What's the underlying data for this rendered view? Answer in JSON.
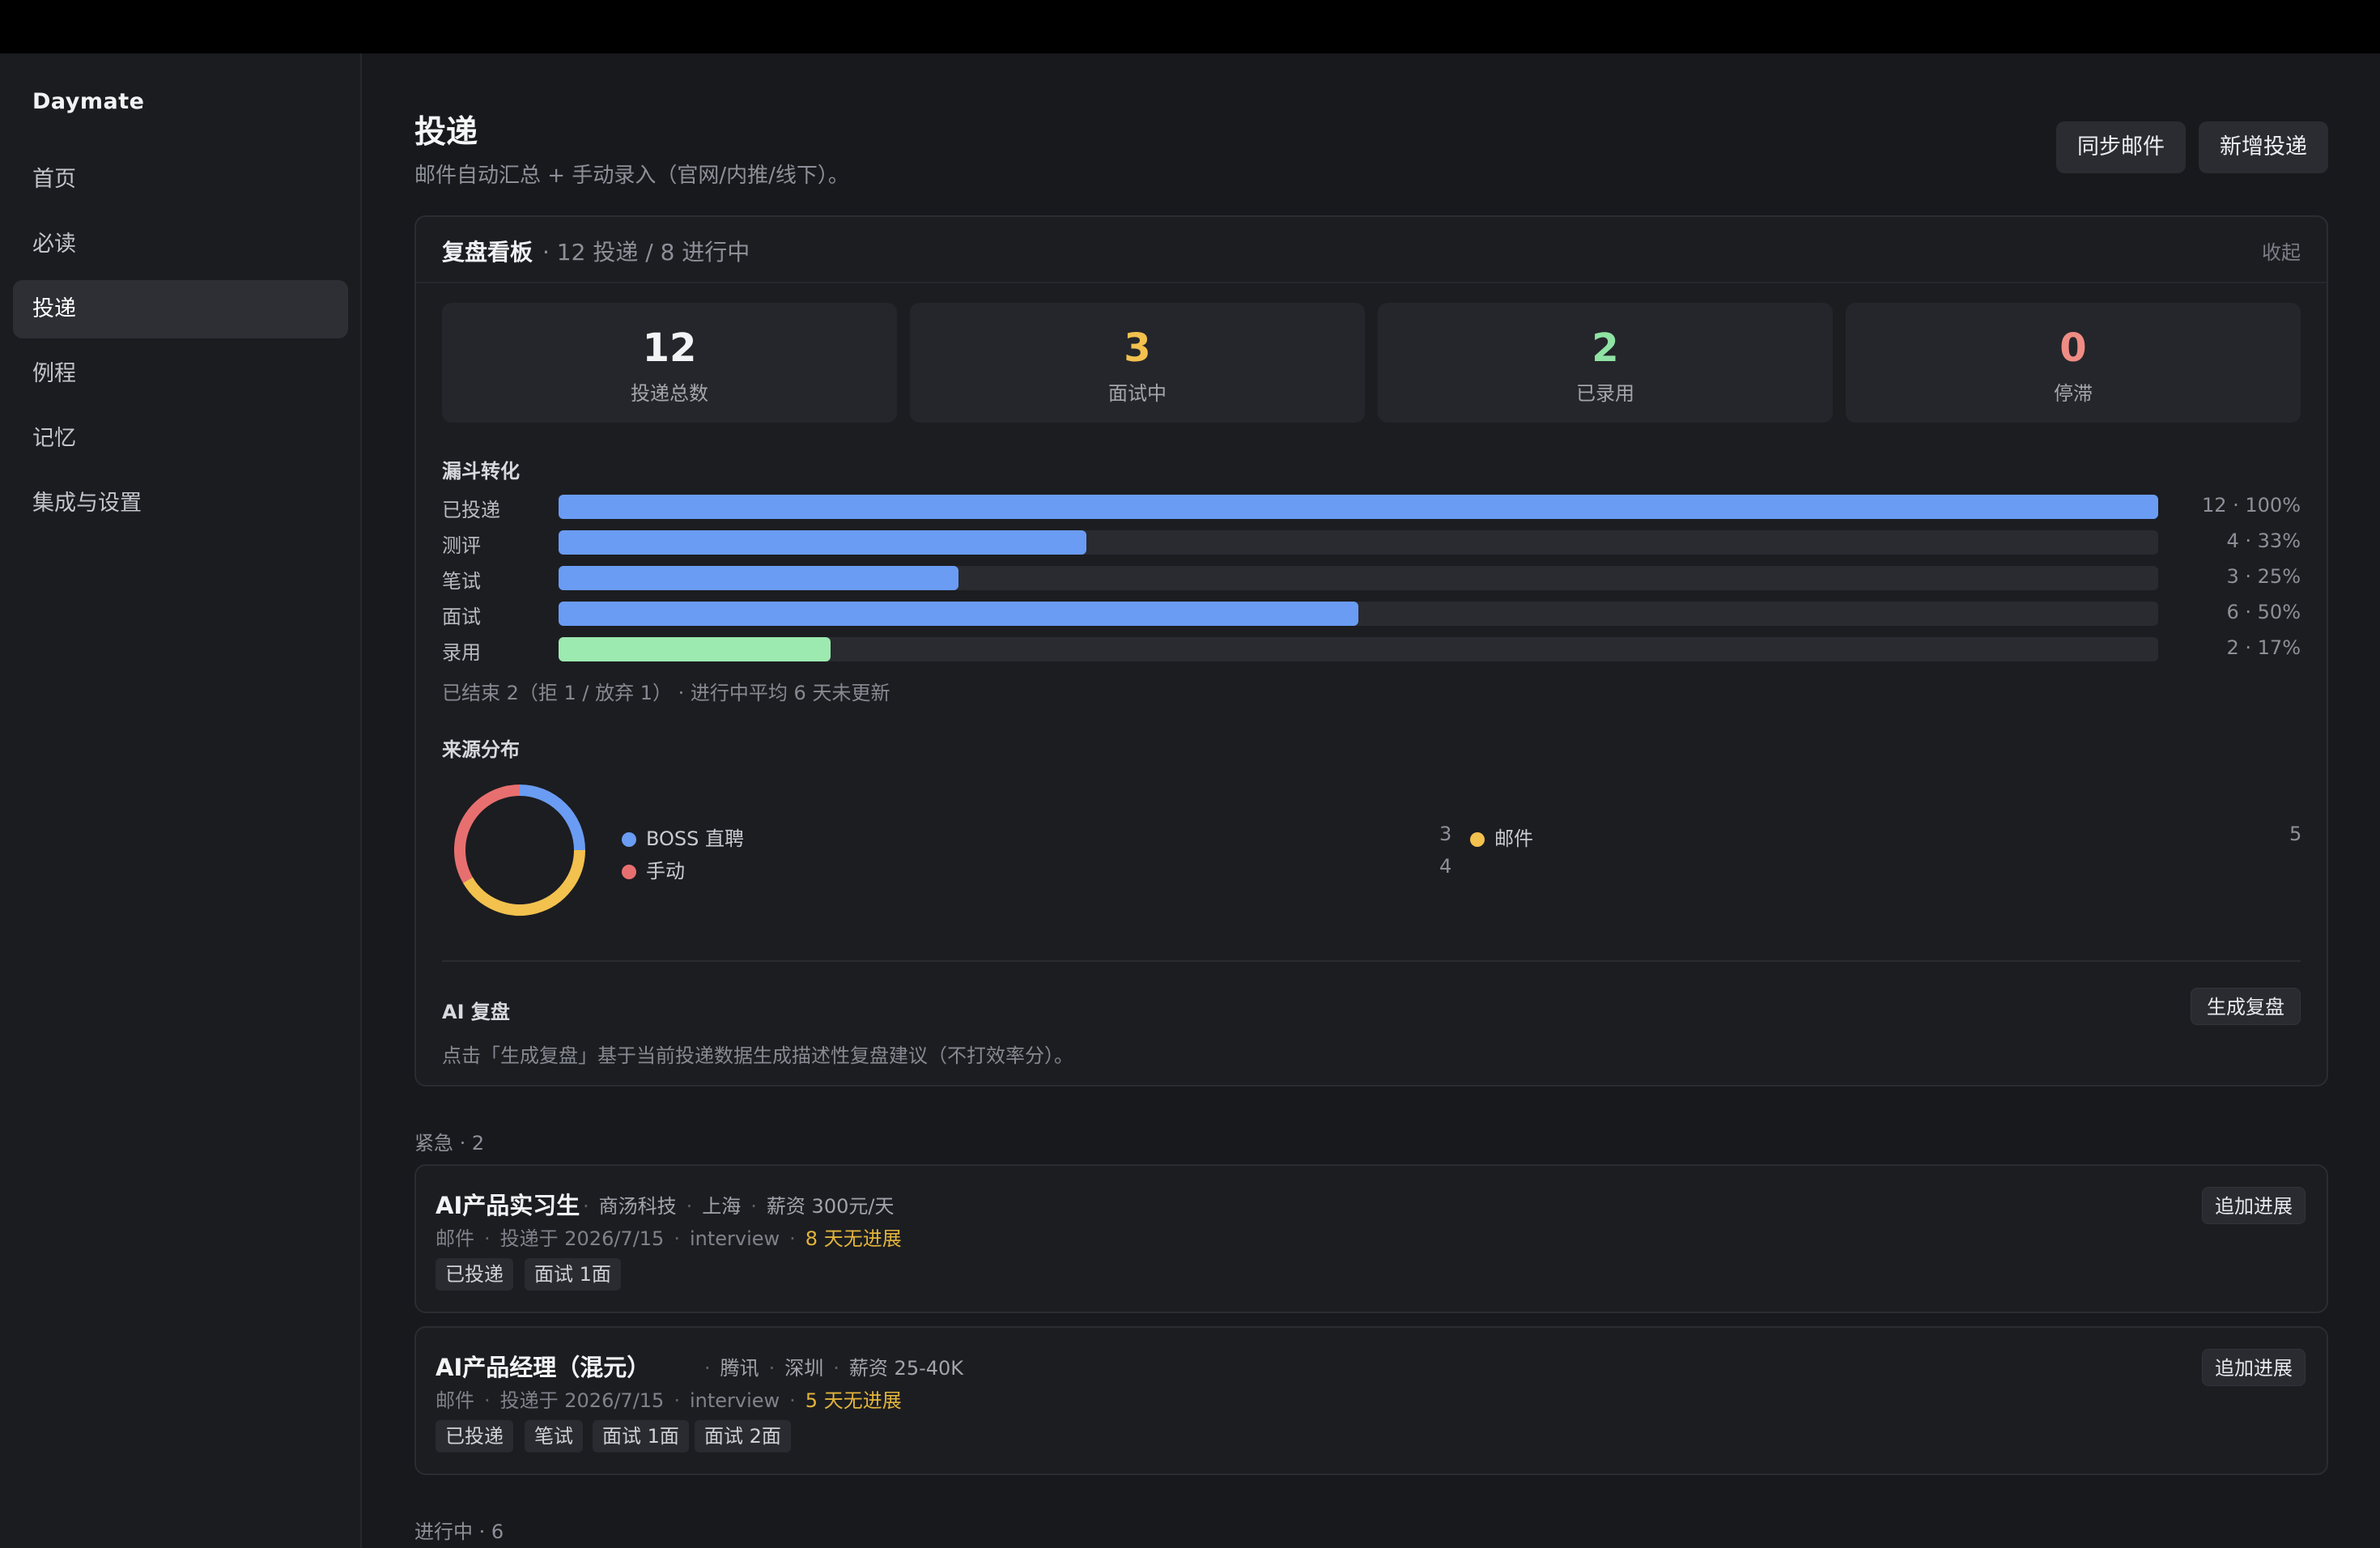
{
  "app": {
    "name": "Daymate"
  },
  "sidebar": {
    "items": [
      {
        "label": "首页",
        "active": false
      },
      {
        "label": "必读",
        "active": false
      },
      {
        "label": "投递",
        "active": true
      },
      {
        "label": "例程",
        "active": false
      },
      {
        "label": "记忆",
        "active": false
      },
      {
        "label": "集成与设置",
        "active": false
      }
    ]
  },
  "header": {
    "title": "投递",
    "subtitle": "邮件自动汇总 + 手动录入（官网/内推/线下）。",
    "sync_label": "同步邮件",
    "add_label": "新增投递"
  },
  "dashboard": {
    "title": "复盘看板",
    "meta": "· 12 投递 / 8 进行中",
    "collapse_label": "收起",
    "stats": [
      {
        "value": "12",
        "label": "投递总数",
        "color": "#f2f3f5"
      },
      {
        "value": "3",
        "label": "面试中",
        "color": "#f2c14e"
      },
      {
        "value": "2",
        "label": "已录用",
        "color": "#8fe3a4"
      },
      {
        "value": "0",
        "label": "停滞",
        "color": "#ef8c84"
      }
    ],
    "funnel_title": "漏斗转化",
    "funnel": [
      {
        "label": "已投递",
        "value": "12 · 100%",
        "fraction": 1.0,
        "color": "#6a9cf3"
      },
      {
        "label": "测评",
        "value": "4 · 33%",
        "fraction": 0.33,
        "color": "#6a9cf3"
      },
      {
        "label": "笔试",
        "value": "3 · 25%",
        "fraction": 0.25,
        "color": "#6a9cf3"
      },
      {
        "label": "面试",
        "value": "6 · 50%",
        "fraction": 0.5,
        "color": "#6a9cf3"
      },
      {
        "label": "录用",
        "value": "2 · 17%",
        "fraction": 0.17,
        "color": "#9ceab0"
      }
    ],
    "funnel_note": "已结束 2（拒 1 / 放弃 1） · 进行中平均 6 天未更新",
    "source_title": "来源分布",
    "sources": [
      {
        "name": "BOSS 直聘",
        "count": "3",
        "color": "#6a9cf3"
      },
      {
        "name": "邮件",
        "count": "5",
        "color": "#f2c14e"
      },
      {
        "name": "手动",
        "count": "4",
        "color": "#e86f6f"
      }
    ],
    "ai_title": "AI 复盘",
    "ai_button": "生成复盘",
    "ai_desc": "点击「生成复盘」基于当前投递数据生成描述性复盘建议（不打效率分）。"
  },
  "urgent": {
    "label": "紧急 · 2",
    "cards": [
      {
        "title": "AI产品实习生",
        "company": "商汤科技",
        "city": "上海",
        "salary": "薪资 300元/天",
        "source": "邮件",
        "date": "投递于 2026/7/15",
        "stage": "interview",
        "stale": "8 天无进展",
        "button": "追加进展",
        "tags": [
          "已投递",
          "面试 1面"
        ]
      },
      {
        "title": "AI产品经理（混元）",
        "company": "腾讯",
        "city": "深圳",
        "salary": "薪资 25-40K",
        "source": "邮件",
        "date": "投递于 2026/7/15",
        "stage": "interview",
        "stale": "5 天无进展",
        "button": "追加进展",
        "tags": [
          "已投递",
          "笔试",
          "面试 1面",
          "面试 2面"
        ]
      }
    ]
  },
  "in_progress": {
    "label": "进行中 · 6"
  }
}
